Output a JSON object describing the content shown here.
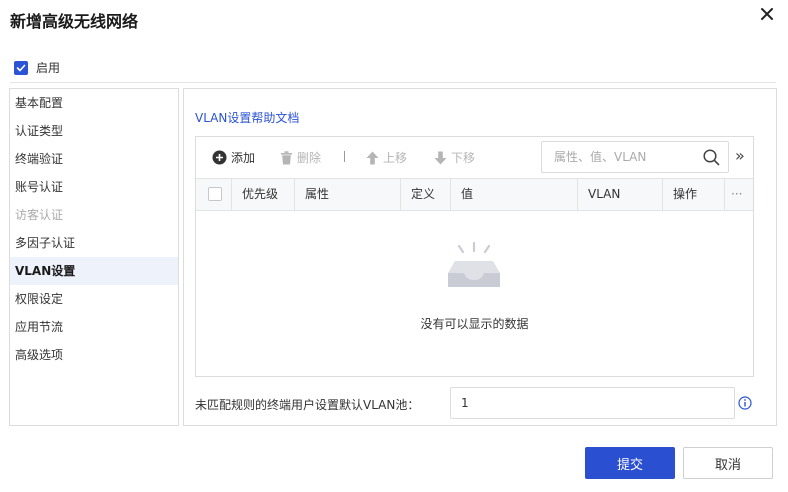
{
  "dialog": {
    "title": "新增高级无线网络"
  },
  "enable": {
    "label": "启用",
    "checked": true
  },
  "sidebar": {
    "items": [
      {
        "label": "基本配置",
        "state": "normal"
      },
      {
        "label": "认证类型",
        "state": "normal"
      },
      {
        "label": "终端验证",
        "state": "normal"
      },
      {
        "label": "账号认证",
        "state": "normal"
      },
      {
        "label": "访客认证",
        "state": "disabled"
      },
      {
        "label": "多因子认证",
        "state": "normal"
      },
      {
        "label": "VLAN设置",
        "state": "active"
      },
      {
        "label": "权限设定",
        "state": "normal"
      },
      {
        "label": "应用节流",
        "state": "normal"
      },
      {
        "label": "高级选项",
        "state": "normal"
      }
    ]
  },
  "main": {
    "help_link": "VLAN设置帮助文档",
    "toolbar": {
      "add": "添加",
      "delete": "删除",
      "separator": "|",
      "move_up": "上移",
      "move_down": "下移",
      "expand": "»"
    },
    "search": {
      "placeholder": "属性、值、VLAN",
      "value": ""
    },
    "table": {
      "columns": [
        "优先级",
        "属性",
        "定义",
        "值",
        "VLAN",
        "操作",
        "···"
      ],
      "rows": [],
      "empty_text": "没有可以显示的数据"
    },
    "default_pool": {
      "label": "未匹配规则的终端用户设置默认VLAN池：",
      "value": "1"
    }
  },
  "footer": {
    "submit": "提交",
    "cancel": "取消"
  },
  "colors": {
    "primary": "#2b4fd1",
    "link": "#2b53d6",
    "active_nav_bg": "#eef2fa",
    "disabled_text": "#aaaaaa"
  }
}
